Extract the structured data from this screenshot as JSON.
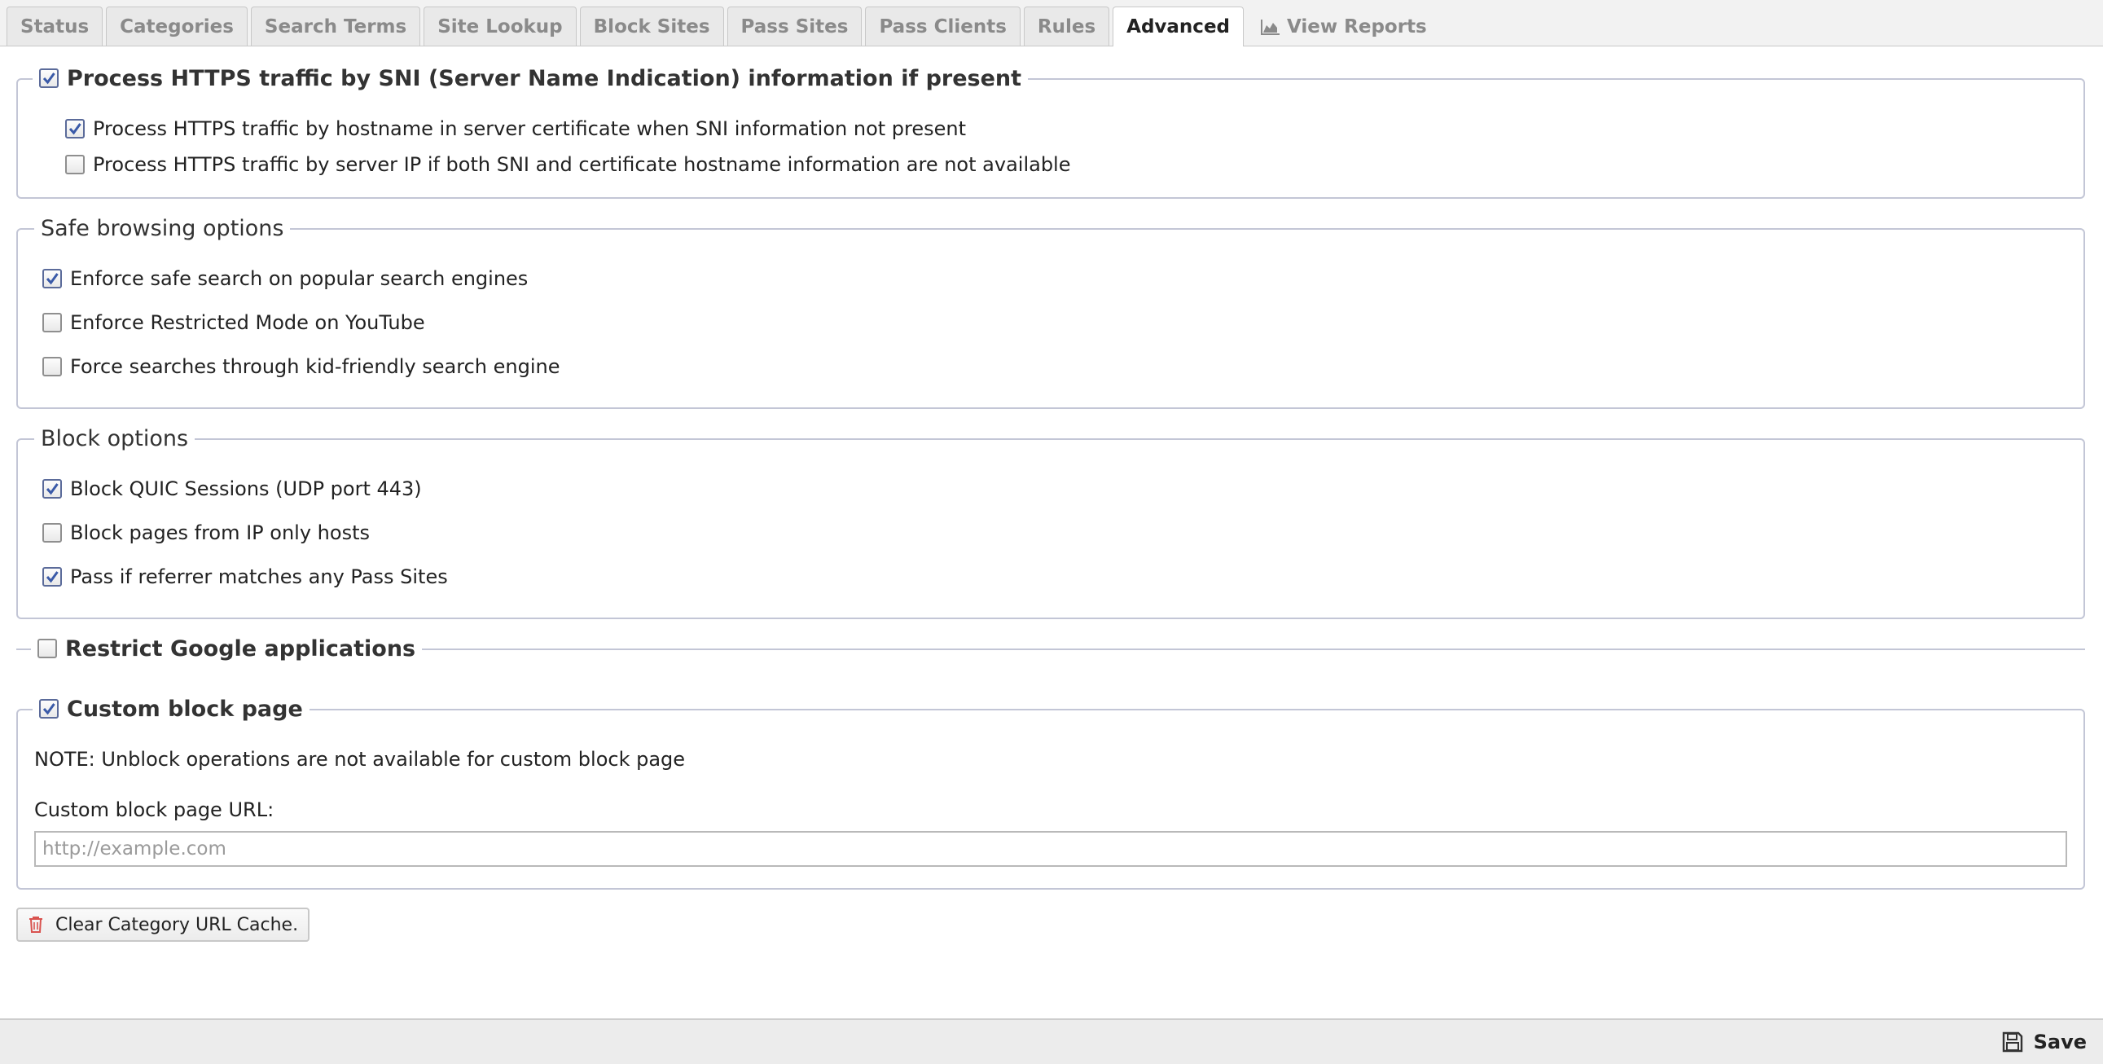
{
  "tabs": [
    {
      "label": "Status"
    },
    {
      "label": "Categories"
    },
    {
      "label": "Search Terms"
    },
    {
      "label": "Site Lookup"
    },
    {
      "label": "Block Sites"
    },
    {
      "label": "Pass Sites"
    },
    {
      "label": "Pass Clients"
    },
    {
      "label": "Rules"
    },
    {
      "label": "Advanced",
      "active": true
    },
    {
      "label": "View Reports",
      "icon": "area-chart-icon"
    }
  ],
  "https": {
    "legend": "Process HTTPS traffic by SNI (Server Name Indication) information if present",
    "legend_checked": true,
    "options": [
      {
        "label": "Process HTTPS traffic by hostname in server certificate when SNI information not present",
        "checked": true
      },
      {
        "label": "Process HTTPS traffic by server IP if both SNI and certificate hostname information are not available",
        "checked": false
      }
    ]
  },
  "safe_browsing": {
    "legend": "Safe browsing options",
    "options": [
      {
        "label": "Enforce safe search on popular search engines",
        "checked": true
      },
      {
        "label": "Enforce Restricted Mode on YouTube",
        "checked": false
      },
      {
        "label": "Force searches through kid-friendly search engine",
        "checked": false
      }
    ]
  },
  "block_options": {
    "legend": "Block options",
    "options": [
      {
        "label": "Block QUIC Sessions (UDP port 443)",
        "checked": true
      },
      {
        "label": "Block pages from IP only hosts",
        "checked": false
      },
      {
        "label": "Pass if referrer matches any Pass Sites",
        "checked": true
      }
    ]
  },
  "google": {
    "legend": "Restrict Google applications",
    "checked": false
  },
  "custom_block": {
    "legend": "Custom block page",
    "checked": true,
    "note": "NOTE: Unblock operations are not available for custom block page",
    "url_label": "Custom block page URL:",
    "url_value": "",
    "url_placeholder": "http://example.com"
  },
  "buttons": {
    "clear_cache": "Clear Category URL Cache.",
    "save": "Save"
  },
  "colors": {
    "accent_check": "#3a5aa8",
    "trash_red": "#d9534f"
  }
}
